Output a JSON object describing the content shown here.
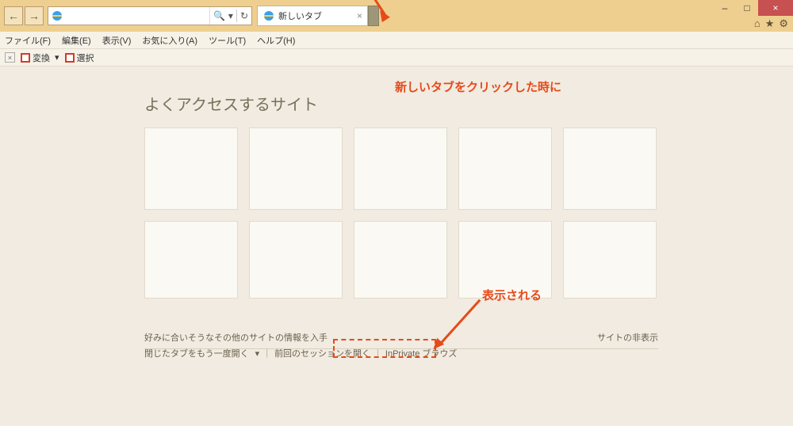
{
  "window": {
    "minimize": "–",
    "maximize": "□",
    "close": "×"
  },
  "nav": {
    "back": "←",
    "forward": "→",
    "search_glyph": "🔍",
    "dropdown_glyph": "▾",
    "refresh_glyph": "↻"
  },
  "tab": {
    "label": "新しいタブ",
    "close_glyph": "×"
  },
  "sysicons": {
    "home": "⌂",
    "star": "★",
    "gear": "⚙"
  },
  "menubar": {
    "file": "ファイル(F)",
    "edit": "編集(E)",
    "view": "表示(V)",
    "favorites": "お気に入り(A)",
    "tools": "ツール(T)",
    "help": "ヘルプ(H)"
  },
  "toolbar": {
    "close": "×",
    "convert": "変換",
    "convert_drop": "▾",
    "select": "選択"
  },
  "page": {
    "title": "よくアクセスするサイト",
    "info_text": "好みに合いそうなその他のサイトの情報を入手",
    "hide_sites": "サイトの非表示",
    "reopen_closed": "閉じたタブをもう一度開く",
    "reopen_drop": "▾",
    "last_session": "前回のセッションを開く",
    "inprivate": "InPrivate ブラウズ"
  },
  "annotations": {
    "a1": "新しいタブをクリックした時に",
    "a2": "表示される"
  }
}
